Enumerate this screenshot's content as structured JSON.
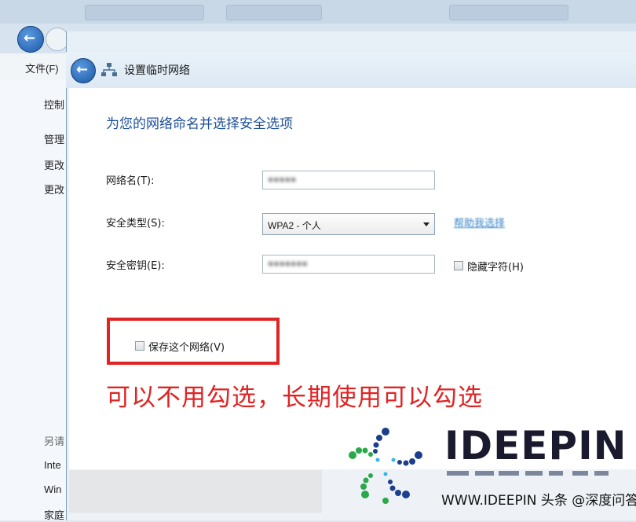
{
  "background_window": {
    "menu_file": "文件(F)",
    "left_items": [
      "控制",
      "管理",
      "更改",
      "更改",
      "另请",
      "Inte",
      "Win",
      "家庭"
    ]
  },
  "wizard": {
    "window_title": "设置临时网络",
    "heading": "为您的网络命名并选择安全选项",
    "network_name_label": "网络名(T):",
    "network_name_value": "●●●●●",
    "security_type_label": "安全类型(S):",
    "security_type_value": "WPA2 - 个人",
    "help_link": "帮助我选择",
    "security_key_label": "安全密钥(E):",
    "security_key_value": "●●●●●●●",
    "hide_chars_label": "隐藏字符(H)",
    "save_network_label": "保存这个网络(V)"
  },
  "annotation": {
    "text": "可以不用勾选，长期使用可以勾选",
    "color": "#e02424"
  },
  "watermark": {
    "brand": "IDEEPIN",
    "url": "WWW.IDEEPIN 头条 @深度问答"
  },
  "colors": {
    "heading": "#1d4f9a",
    "highlight": "#e02424",
    "link": "#3a86c8"
  }
}
